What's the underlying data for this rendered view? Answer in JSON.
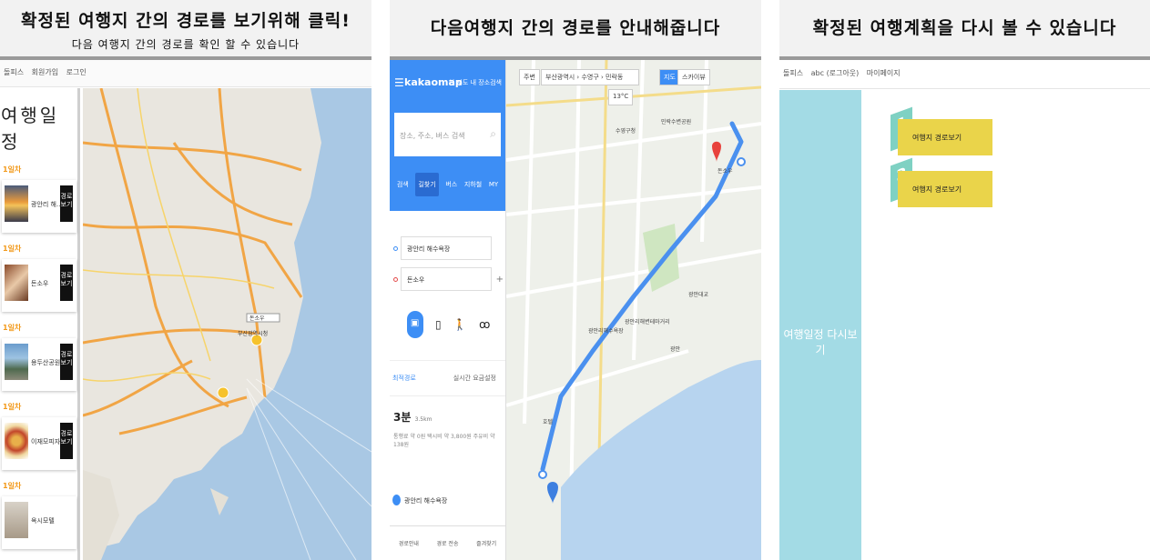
{
  "panel1": {
    "caption": "확정된 여행지 간의 경로를 보기위해 클릭!",
    "subcaption": "다음 여행지 간의 경로를 확인 할 수 있습니다",
    "topbar": [
      "돌피스",
      "회원가입",
      "로그인"
    ],
    "itinerary_title": "여행일정",
    "days": [
      {
        "label": "1일차",
        "place": "광안리 해...",
        "button": "경로보기"
      },
      {
        "label": "1일차",
        "place": "돈소우",
        "button": "경로보기"
      },
      {
        "label": "1일차",
        "place": "용두산공원",
        "button": "경로보기"
      },
      {
        "label": "1일차",
        "place": "이재모피자",
        "button": "경로보기"
      },
      {
        "label": "1일차",
        "place": "옥시모텔",
        "button": ""
      }
    ],
    "map_labels": [
      "부산광역시청",
      "돈소우"
    ]
  },
  "panel2": {
    "caption": "다음여행지 간의 경로를 안내해줍니다",
    "logo": "kakaomap",
    "header_link": "현 지도 내 장소검색",
    "search_placeholder": "장소, 주소, 버스 검색",
    "tabs": [
      "검색",
      "길찾기",
      "버스",
      "지하철",
      "MY"
    ],
    "origin": "광안리 해수욕장",
    "destination": "돈소우",
    "route_option": "최적경로",
    "options_right": "실시간  요금설정",
    "duration": "3분",
    "distance": "3.5km",
    "details": "통행료 약 0원  택시비 약 3,800원  주유비 약 138원",
    "dest_item": "광안리 해수욕장",
    "footer": [
      "경로안내",
      "경로 전송",
      "즐겨찾기"
    ],
    "map_toolbar": [
      "주변",
      "부산광역시",
      "수영구",
      "민락동",
      "13°C",
      "지도",
      "스카이뷰"
    ],
    "map_labels": [
      "광안리해수욕장",
      "민락수변공원",
      "광안대교",
      "돈소우",
      "광안리해변테마거리",
      "수영구청",
      "호텔",
      "광안"
    ]
  },
  "panel3": {
    "caption": "확정된 여행계획을 다시 볼 수 있습니다",
    "topbar": [
      "돌피스",
      "abc (로그아웃)",
      "마이페이지"
    ],
    "sidebar_text": "여행일정 다시보기",
    "routes": [
      {
        "num": "1",
        "label": "여행지 경로보기"
      },
      {
        "num": "2",
        "label": "여행지 경로보기"
      }
    ]
  },
  "colors": {
    "kakao_blue": "#3d8ef5",
    "route_yellow": "#ead44a",
    "route_teal": "#7fd1c3",
    "sidebar_cyan": "#a3dbe5",
    "day_orange": "#f29a1c"
  }
}
